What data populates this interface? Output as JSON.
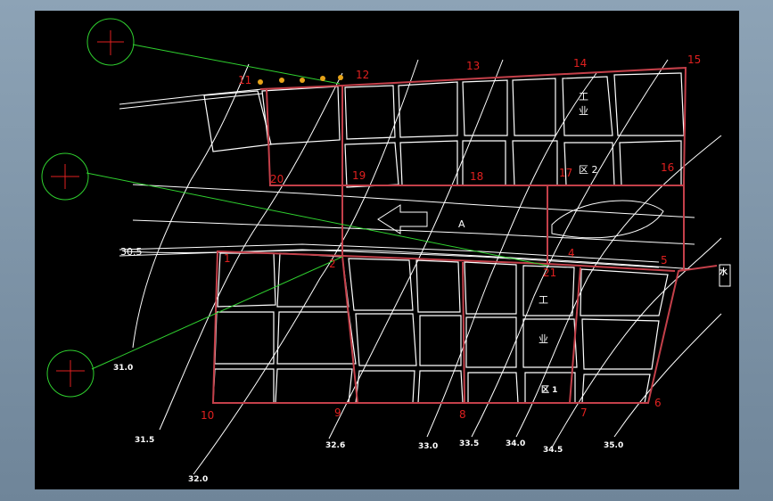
{
  "colors": {
    "background": "#000000",
    "contour": "#ffffff",
    "boundary": "#c4404a",
    "point_label": "#e0201f",
    "survey_line": "#2fd12f",
    "wells": "#e6a319"
  },
  "point_labels": [
    "1",
    "2",
    "4",
    "5",
    "6",
    "7",
    "8",
    "9",
    "10",
    "11",
    "12",
    "13",
    "14",
    "15",
    "16",
    "17",
    "18",
    "19",
    "20",
    "21"
  ],
  "contour_labels": [
    "30.5",
    "31.0",
    "31.5",
    "32.0",
    "32.6",
    "33.0",
    "33.5",
    "34.0",
    "34.5",
    "35.0"
  ],
  "block_labels": {
    "area_2": "区 2",
    "area_1": "区 1",
    "gong": "工",
    "ye": "业",
    "gong2": "工",
    "ye2": "业",
    "a": "A",
    "water": "水"
  }
}
